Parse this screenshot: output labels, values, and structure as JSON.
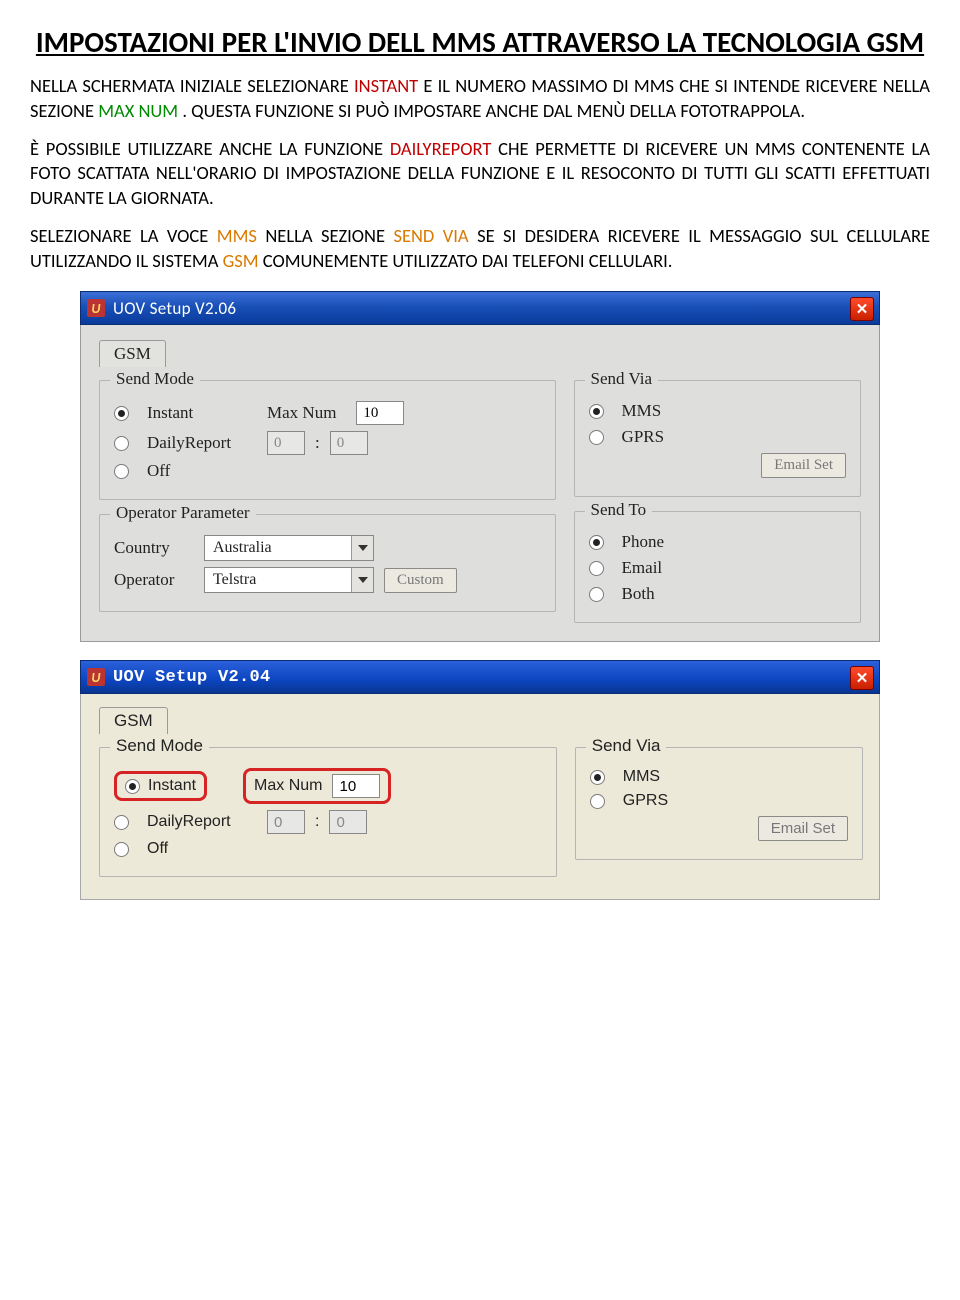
{
  "doc": {
    "title": "IMPOSTAZIONI PER L'INVIO DELL MMS ATTRAVERSO LA TECNOLOGIA GSM",
    "p1a": "NELLA SCHERMATA INIZIALE SELEZIONARE ",
    "p1_kw1": "INSTANT",
    "p1b": " E IL NUMERO MASSIMO DI MMS CHE SI INTENDE RICEVERE NELLA SEZIONE ",
    "p1_kw2": "MAX NUM",
    "p1c": ". QUESTA FUNZIONE SI PUÒ IMPOSTARE ANCHE DAL MENÙ DELLA FOTOTRAPPOLA.",
    "p2a": "È POSSIBILE UTILIZZARE ANCHE LA FUNZIONE ",
    "p2_kw1": "DAILYREPORT",
    "p2b": " CHE PERMETTE DI RICEVERE UN MMS CONTENENTE LA FOTO SCATTATA NELL'ORARIO DI IMPOSTAZIONE DELLA FUNZIONE E IL RESOCONTO DI TUTTI GLI SCATTI EFFETTUATI DURANTE LA GIORNATA.",
    "p3a": "SELEZIONARE LA VOCE ",
    "p3_kw1": "MMS",
    "p3b": " NELLA SEZIONE ",
    "p3_kw2": "SEND VIA",
    "p3c": " SE SI DESIDERA RICEVERE IL MESSAGGIO SUL CELLULARE UTILIZZANDO IL SISTEMA ",
    "p3_kw3": "GSM",
    "p3d": " COMUNEMENTE UTILIZZATO DAI TELEFONI CELLULARI."
  },
  "shot1": {
    "title": "UOV Setup V2.06",
    "tab": "GSM",
    "sendmode": {
      "legend": "Send Mode",
      "instant": "Instant",
      "daily": "DailyReport",
      "off": "Off",
      "maxnum_label": "Max Num",
      "maxnum_value": "10",
      "time_h": "0",
      "time_m": "0"
    },
    "sendvia": {
      "legend": "Send Via",
      "mms": "MMS",
      "gprs": "GPRS",
      "emailset": "Email Set"
    },
    "opparam": {
      "legend": "Operator Parameter",
      "country_label": "Country",
      "country_value": "Australia",
      "operator_label": "Operator",
      "operator_value": "Telstra",
      "custom": "Custom"
    },
    "sendto": {
      "legend": "Send To",
      "phone": "Phone",
      "email": "Email",
      "both": "Both"
    }
  },
  "shot2": {
    "title": "UOV Setup V2.04",
    "tab": "GSM",
    "sendmode": {
      "legend": "Send Mode",
      "instant": "Instant",
      "daily": "DailyReport",
      "off": "Off",
      "maxnum_label": "Max Num",
      "maxnum_value": "10",
      "time_h": "0",
      "time_m": "0"
    },
    "sendvia": {
      "legend": "Send Via",
      "mms": "MMS",
      "gprs": "GPRS",
      "emailset": "Email Set"
    }
  }
}
